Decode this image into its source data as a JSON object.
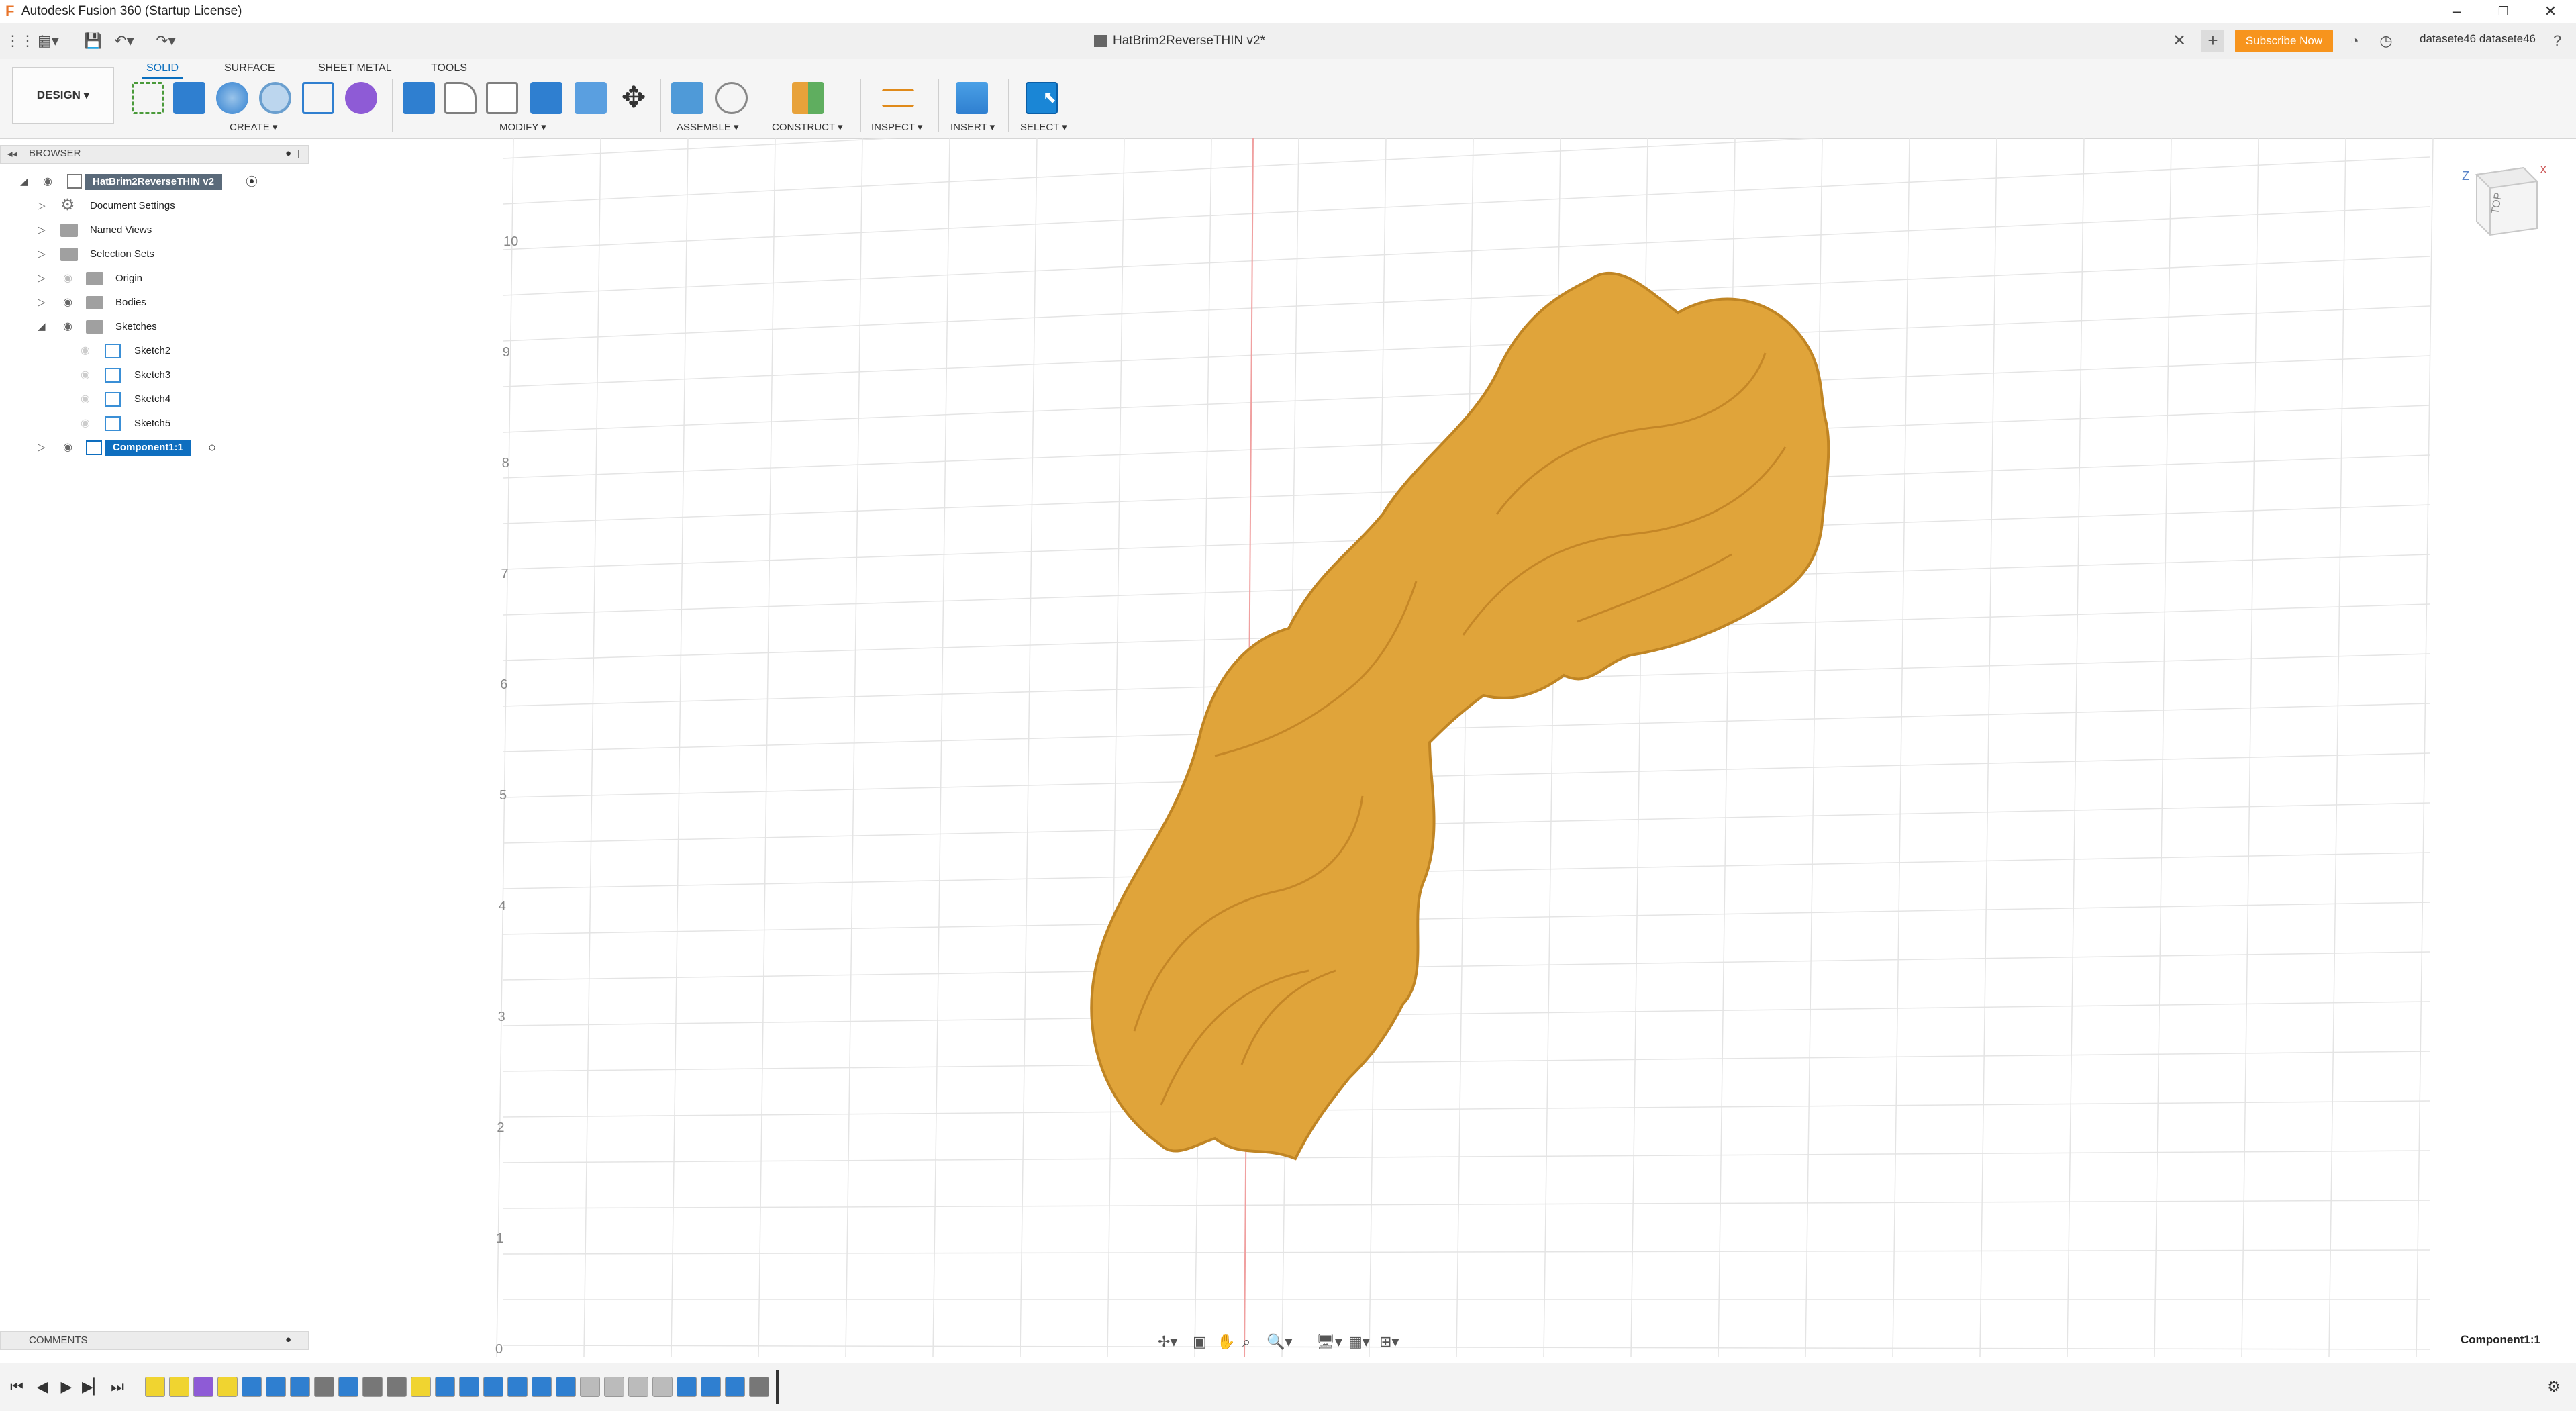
{
  "app": {
    "title": "Autodesk Fusion 360 (Startup License)",
    "logo": "F"
  },
  "window": {
    "minimize": "–",
    "restore": "❐",
    "close": "✕"
  },
  "tabbar": {
    "doc_tab": "HatBrim2ReverseTHIN v2*",
    "close": "✕",
    "new_tab": "+",
    "subscribe": "Subscribe Now",
    "user": "datasete46 datasete46"
  },
  "workspace": {
    "label": "DESIGN ▾"
  },
  "ribbon": {
    "tabs": [
      "SOLID",
      "SURFACE",
      "SHEET METAL",
      "TOOLS"
    ],
    "groups": [
      "CREATE ▾",
      "MODIFY ▾",
      "ASSEMBLE ▾",
      "CONSTRUCT ▾",
      "INSPECT ▾",
      "INSERT ▾",
      "SELECT ▾"
    ]
  },
  "browser": {
    "title": "BROWSER",
    "root": "HatBrim2ReverseTHIN v2",
    "items": [
      {
        "label": "Document Settings"
      },
      {
        "label": "Named Views"
      },
      {
        "label": "Selection Sets"
      },
      {
        "label": "Origin"
      },
      {
        "label": "Bodies"
      },
      {
        "label": "Sketches"
      },
      {
        "label": "Sketch2"
      },
      {
        "label": "Sketch3"
      },
      {
        "label": "Sketch4"
      },
      {
        "label": "Sketch5"
      },
      {
        "label": "Component1:1"
      }
    ]
  },
  "comments": {
    "title": "COMMENTS"
  },
  "viewport": {
    "grid_labels": [
      "10",
      "9",
      "8",
      "7",
      "6",
      "5",
      "4",
      "3",
      "2",
      "1",
      "0"
    ],
    "viewcube_label": "TOP",
    "axis_z": "Z",
    "axis_x": "X",
    "component_label": "Component1:1",
    "body_color": "#e0a43a"
  },
  "colors": {
    "accent": "#0a6fbf",
    "subscribe": "#f7941d",
    "selection": "#0e6ebf"
  }
}
